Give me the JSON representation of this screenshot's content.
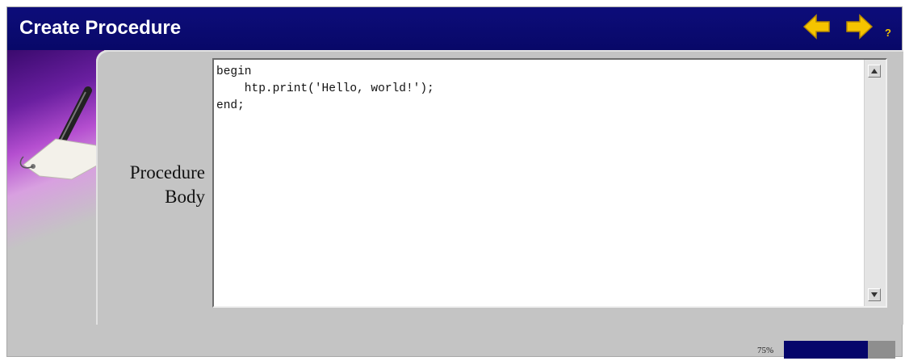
{
  "header": {
    "title": "Create Procedure",
    "help_label": "?",
    "back_icon": "arrow-left-icon",
    "next_icon": "arrow-right-icon",
    "accent_color": "#f5c400",
    "bar_color": "#0a0a70"
  },
  "form": {
    "label_line1": "Procedure",
    "label_line2": "Body",
    "code_lines": [
      "begin",
      "    htp.print('Hello, world!');",
      "end;"
    ]
  },
  "progress": {
    "label": "75%",
    "fraction": 0.75
  },
  "decoration_icon": "pen-tag-icon"
}
